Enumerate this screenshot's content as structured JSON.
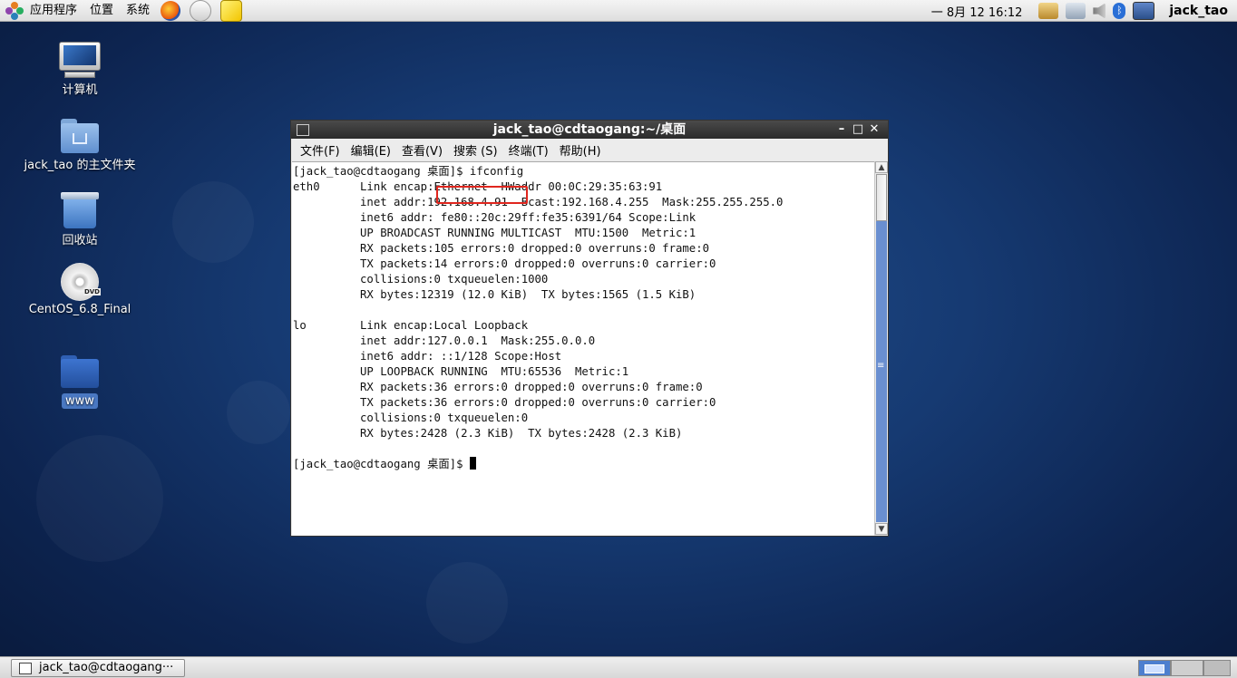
{
  "top_panel": {
    "menus": [
      "应用程序",
      "位置",
      "系统"
    ],
    "clock": "一 8月 12 16:12",
    "user": "jack_tao",
    "launchers": [
      "firefox-icon",
      "mail-icon",
      "notes-icon"
    ],
    "tray_icons": [
      "update-icon",
      "network-icon",
      "volume-icon",
      "bluetooth-icon",
      "display-icon"
    ]
  },
  "desktop_icons": [
    {
      "label": "计算机",
      "icon": "computer-icon"
    },
    {
      "label": "jack_tao 的主文件夹",
      "icon": "home-folder-icon"
    },
    {
      "label": "回收站",
      "icon": "trash-icon"
    },
    {
      "label": "CentOS_6.8_Final",
      "icon": "dvd-icon"
    },
    {
      "label": "www",
      "icon": "folder-icon"
    }
  ],
  "terminal": {
    "title": "jack_tao@cdtaogang:~/桌面",
    "menu": [
      "文件(F)",
      "编辑(E)",
      "查看(V)",
      "搜索 (S)",
      "终端(T)",
      "帮助(H)"
    ],
    "prompt": "[jack_tao@cdtaogang 桌面]$ ",
    "command": "ifconfig",
    "output": [
      "eth0      Link encap:Ethernet  HWaddr 00:0C:29:35:63:91",
      "          inet addr:192.168.4.91  Bcast:192.168.4.255  Mask:255.255.255.0",
      "          inet6 addr: fe80::20c:29ff:fe35:6391/64 Scope:Link",
      "          UP BROADCAST RUNNING MULTICAST  MTU:1500  Metric:1",
      "          RX packets:105 errors:0 dropped:0 overruns:0 frame:0",
      "          TX packets:14 errors:0 dropped:0 overruns:0 carrier:0",
      "          collisions:0 txqueuelen:1000",
      "          RX bytes:12319 (12.0 KiB)  TX bytes:1565 (1.5 KiB)",
      "",
      "lo        Link encap:Local Loopback",
      "          inet addr:127.0.0.1  Mask:255.0.0.0",
      "          inet6 addr: ::1/128 Scope:Host",
      "          UP LOOPBACK RUNNING  MTU:65536  Metric:1",
      "          RX packets:36 errors:0 dropped:0 overruns:0 frame:0",
      "          TX packets:36 errors:0 dropped:0 overruns:0 carrier:0",
      "          collisions:0 txqueuelen:0",
      "          RX bytes:2428 (2.3 KiB)  TX bytes:2428 (2.3 KiB)",
      ""
    ],
    "highlighted_value": "192.168.4.91"
  },
  "taskbar": {
    "window_button": "jack_tao@cdtaogang···"
  },
  "colors": {
    "desktop": "#163a72",
    "highlight_box": "#e0261e",
    "titlebar": "#2b2b2b"
  }
}
